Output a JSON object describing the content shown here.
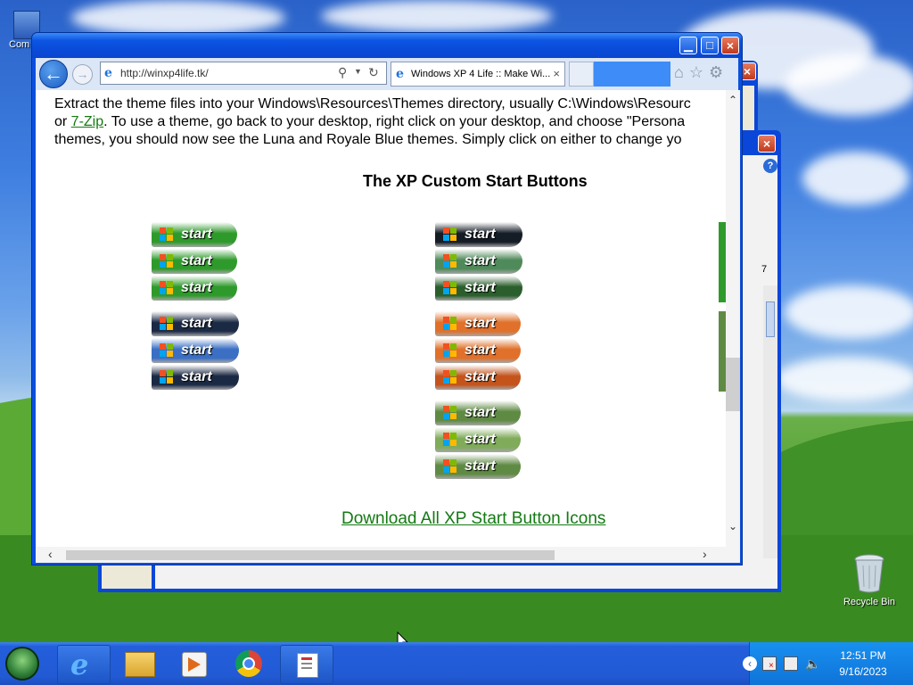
{
  "desktop": {
    "icons": [
      {
        "label": "Com"
      },
      {
        "label": "Recycle Bin"
      }
    ]
  },
  "browser": {
    "address": "http://winxp4life.tk/",
    "tab_title": "Windows XP 4 Life :: Make Wi...",
    "tab_close": "×",
    "back_glyph": "←",
    "forward_glyph": "→",
    "page": {
      "line1": "Extract the theme files into your Windows\\Resources\\Themes directory, usually C:\\Windows\\Resourc",
      "line2_pre": "or ",
      "line2_link": "7-Zip",
      "line2_post": ".  To use a theme, go back to your desktop, right click on your desktop, and choose \"Persona",
      "line3": "themes, you should now see the Luna and Royale Blue themes.  Simply click on either to change yo",
      "heading": "The XP Custom Start Buttons",
      "start_label": "start",
      "download_link": "Download All XP Start Button Icons"
    },
    "start_buttons": {
      "left_group1": [
        "green",
        "green",
        "green"
      ],
      "left_group2": [
        "navy",
        "blue",
        "navy"
      ],
      "right_group1": [
        "black",
        "sage",
        "darkgreen"
      ],
      "right_group2": [
        "orange",
        "orange",
        "darkorange"
      ],
      "right_group3": [
        "olive",
        "lightolive",
        "olive"
      ],
      "colors": {
        "green": "#2f9a2c",
        "navy": "#1b2a44",
        "blue": "#3a6fc4",
        "black": "#141c26",
        "sage": "#4f8a5a",
        "darkgreen": "#2a5e2c",
        "orange": "#e0702a",
        "darkorange": "#c4541c",
        "olive": "#5f8a44",
        "lightolive": "#7fab5a"
      }
    }
  },
  "background_window": {
    "partial_label": "7"
  },
  "taskbar": {
    "clock_time": "12:51 PM",
    "clock_date": "9/16/2023"
  }
}
